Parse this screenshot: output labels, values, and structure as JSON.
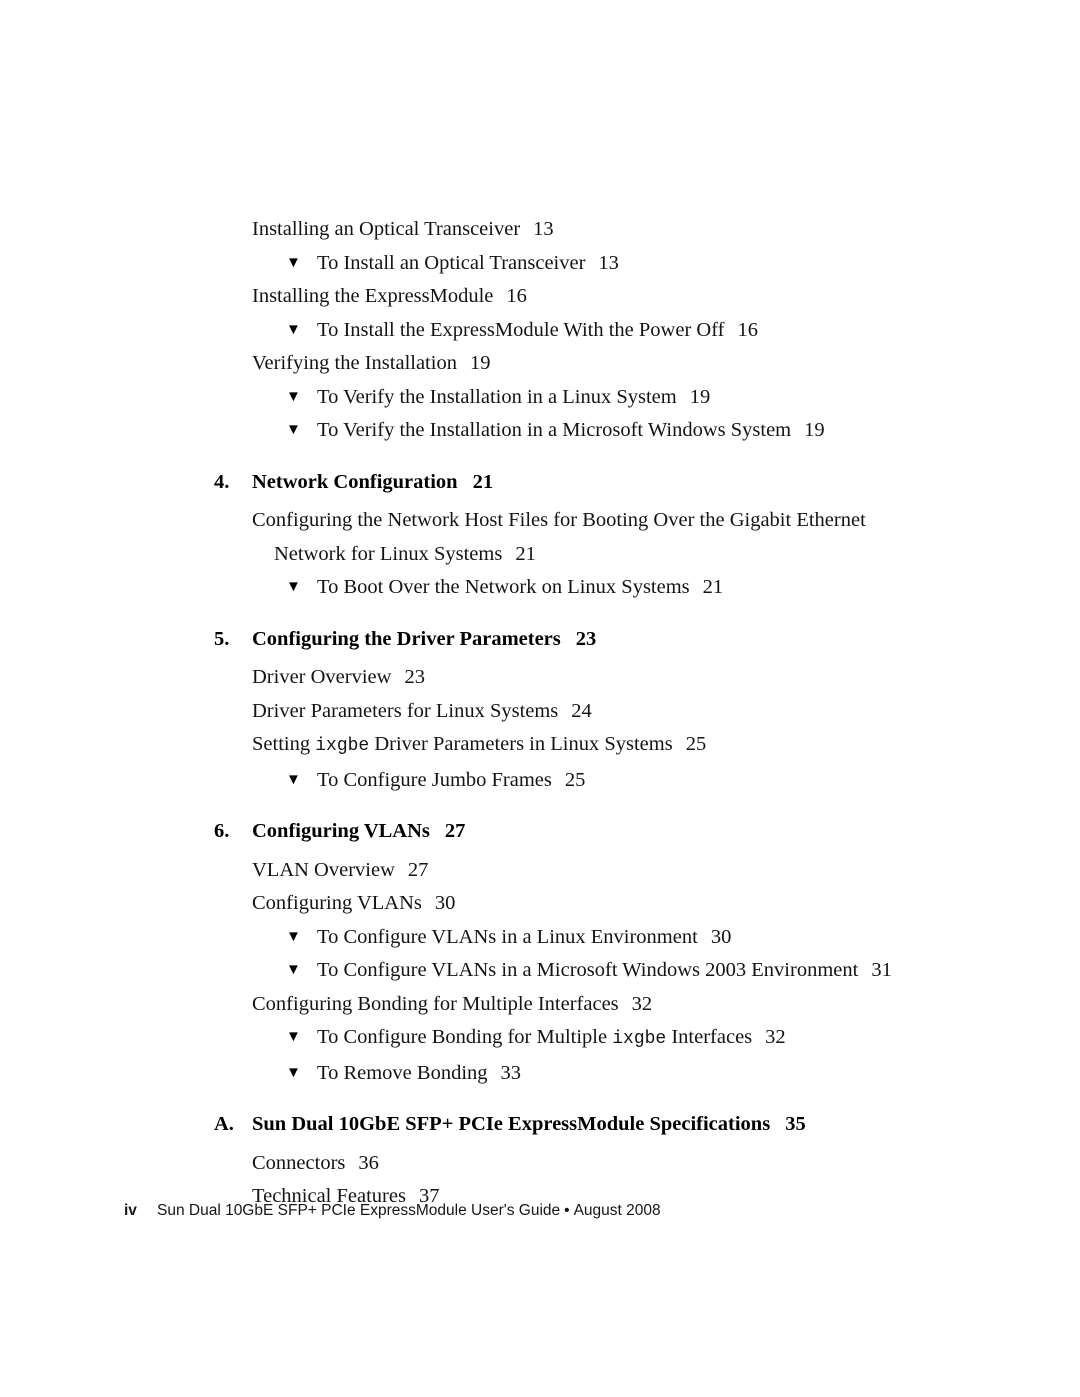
{
  "page": {
    "folio": "iv",
    "footer_title": "Sun Dual 10GbE SFP+ PCIe ExpressModule User's Guide",
    "footer_separator": "•",
    "footer_date": "August 2008"
  },
  "icons": {
    "triangle": "▼"
  },
  "toc": {
    "groups": [
      {
        "id": "chapter-3-continued",
        "entries": [
          {
            "level": 1,
            "text": "Installing an Optical Transceiver",
            "page": "13"
          },
          {
            "level": 2,
            "text": "To Install an Optical Transceiver",
            "page": "13"
          },
          {
            "level": 1,
            "text": "Installing the ExpressModule",
            "page": "16"
          },
          {
            "level": 2,
            "text": "To Install the ExpressModule With the Power Off",
            "page": "16"
          },
          {
            "level": 1,
            "text": "Verifying the Installation",
            "page": "19"
          },
          {
            "level": 2,
            "text": "To Verify the Installation in a Linux System",
            "page": "19"
          },
          {
            "level": 2,
            "text": "To Verify the Installation in a Microsoft Windows System",
            "page": "19"
          }
        ]
      },
      {
        "id": "chapter-4",
        "chapter": {
          "number": "4.",
          "title": "Network Configuration",
          "page": "21"
        },
        "entries": [
          {
            "level": 1,
            "text": "Configuring the Network Host Files for Booting Over the Gigabit Ethernet",
            "text_wrapped": "Network for Linux Systems",
            "page": "21"
          },
          {
            "level": 2,
            "text": "To Boot Over the Network on Linux Systems",
            "page": "21"
          }
        ]
      },
      {
        "id": "chapter-5",
        "chapter": {
          "number": "5.",
          "title": "Configuring the Driver Parameters",
          "page": "23"
        },
        "entries": [
          {
            "level": 1,
            "text": "Driver Overview",
            "page": "23"
          },
          {
            "level": 1,
            "text": "Driver Parameters for Linux Systems",
            "page": "24"
          },
          {
            "level": 1,
            "text_before": "Setting ",
            "mono": "ixgbe",
            "text_after": " Driver Parameters in Linux Systems",
            "page": "25"
          },
          {
            "level": 2,
            "text": "To Configure Jumbo Frames",
            "page": "25"
          }
        ]
      },
      {
        "id": "chapter-6",
        "chapter": {
          "number": "6.",
          "title": "Configuring VLANs",
          "page": "27"
        },
        "entries": [
          {
            "level": 1,
            "text": "VLAN Overview",
            "page": "27"
          },
          {
            "level": 1,
            "text": "Configuring VLANs",
            "page": "30"
          },
          {
            "level": 2,
            "text": "To Configure VLANs in a Linux Environment",
            "page": "30"
          },
          {
            "level": 2,
            "text": "To Configure VLANs in a Microsoft Windows 2003 Environment",
            "page": "31"
          },
          {
            "level": 1,
            "text": "Configuring Bonding for Multiple Interfaces",
            "page": "32"
          },
          {
            "level": 2,
            "text_before": "To Configure Bonding for Multiple ",
            "mono": "ixgbe",
            "text_after": " Interfaces",
            "page": "32"
          },
          {
            "level": 2,
            "text": "To Remove Bonding",
            "page": "33"
          }
        ]
      },
      {
        "id": "appendix-a",
        "chapter": {
          "number": "A.",
          "title": "Sun Dual 10GbE SFP+ PCIe ExpressModule Specifications",
          "page": "35"
        },
        "entries": [
          {
            "level": 1,
            "text": "Connectors",
            "page": "36"
          },
          {
            "level": 1,
            "text": "Technical Features",
            "page": "37"
          }
        ]
      }
    ]
  }
}
